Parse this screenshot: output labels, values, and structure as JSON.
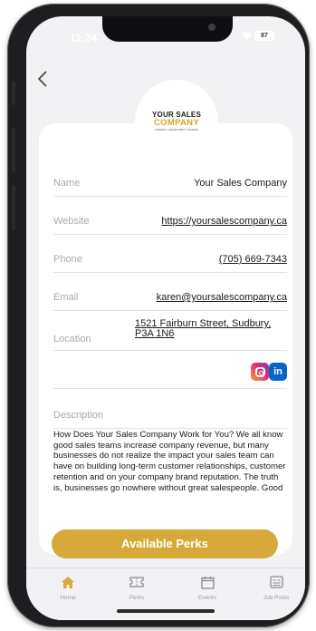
{
  "status": {
    "time": "11:24",
    "battery": "87"
  },
  "logo": {
    "line1": "YOUR SALES",
    "line2": "COMPANY",
    "tagline": "STRATEGY • RECRUITMENT • TRAINING"
  },
  "fields": {
    "name": {
      "label": "Name",
      "value": "Your Sales Company"
    },
    "website": {
      "label": "Website",
      "value": "https://yoursalescompany.ca"
    },
    "phone": {
      "label": "Phone",
      "value": "(705) 669-7343"
    },
    "email": {
      "label": "Email",
      "value": "karen@yoursalescompany.ca"
    },
    "location": {
      "label": "Location",
      "value": "1521 Fairburn Street, Sudbury, P3A 1N6"
    }
  },
  "social": {
    "instagram": "instagram-icon",
    "linkedin": "in"
  },
  "description": {
    "label": "Description",
    "text": "How Does Your Sales Company Work for You? We all know good sales teams increase company revenue, but many businesses do not realize the impact your sales team can have on building long-term customer relationships, customer retention and on your company brand reputation. The truth is, businesses go nowhere without great salespeople. Good"
  },
  "perks_button": "Available Perks",
  "tabs": [
    {
      "label": "Home",
      "active": true
    },
    {
      "label": "Perks",
      "active": false
    },
    {
      "label": "Events",
      "active": false
    },
    {
      "label": "Job Posts",
      "active": false
    }
  ],
  "colors": {
    "accent": "#d7a93a",
    "linkedin": "#0a66c2"
  }
}
